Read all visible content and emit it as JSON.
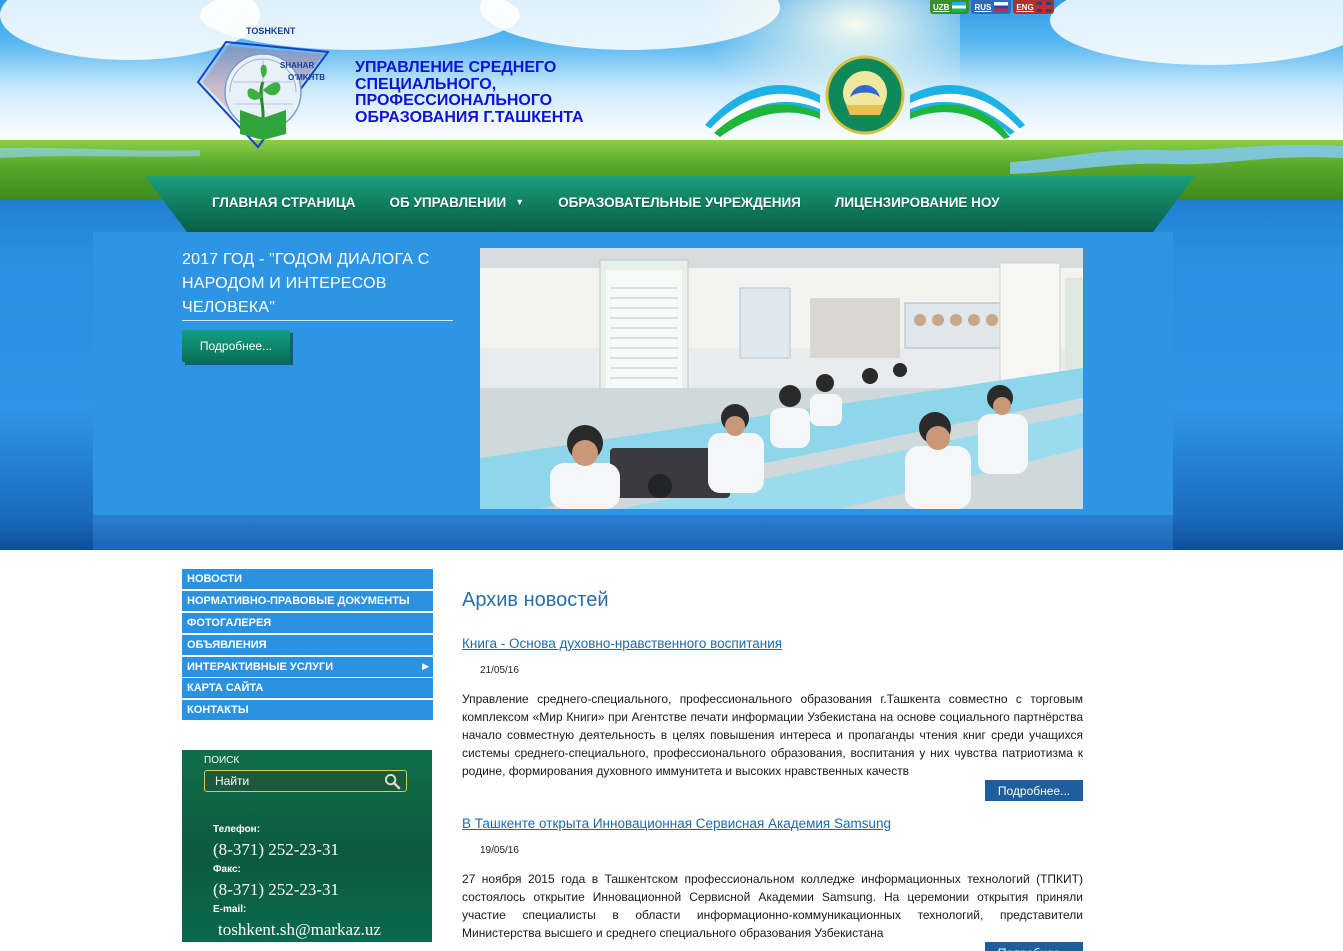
{
  "languages": [
    {
      "code": "UZB"
    },
    {
      "code": "RUS"
    },
    {
      "code": "ENG"
    }
  ],
  "logo": {
    "text_lines": [
      "TOSHKENT",
      "SHAHAR",
      "O'MKHTB"
    ]
  },
  "site_title": "УПРАВЛЕНИЕ СРЕДНЕГО СПЕЦИАЛЬНОГО, ПРОФЕССИОНАЛЬНОГО ОБРАЗОВАНИЯ г.ТАШКЕНТА",
  "nav": [
    {
      "label": "ГЛАВНАЯ СТРАНИЦА"
    },
    {
      "label": "ОБ УПРАВЛЕНИИ",
      "dropdown": true
    },
    {
      "label": "ОБРАЗОВАТЕЛЬНЫЕ УЧРЕЖДЕНИЯ"
    },
    {
      "label": "ЛИЦЕНЗИРОВАНИЕ НОУ"
    }
  ],
  "hero": {
    "slogan": "2017 ГОД - \"ГОДОМ ДИАЛОГА С НАРОДОМ И ИНТЕРЕСОВ ЧЕЛОВЕКА\"",
    "more_label": "Подробнее..."
  },
  "sidebar": {
    "menu": [
      {
        "label": "НОВОСТИ"
      },
      {
        "label": "НОРМАТИВНО-ПРАВОВЫЕ ДОКУМЕНТЫ"
      },
      {
        "label": "ФОТОГАЛЕРЕЯ"
      },
      {
        "label": "ОБЪЯВЛЕНИЯ"
      },
      {
        "label": "ИНТЕРАКТИВНЫЕ УСЛУГИ",
        "submenu": true
      },
      {
        "label": "КАРТА САЙТА"
      },
      {
        "label": "КОНТАКТЫ"
      }
    ],
    "search": {
      "label": "ПОИСК",
      "placeholder": "Найти"
    },
    "contacts": {
      "phone_label": "Телефон:",
      "phone": "(8-371) 252-23-31",
      "fax_label": "Факс:",
      "fax": "(8-371) 252-23-31",
      "email_label": "E-mail:",
      "email": "toshkent.sh@markaz.uz"
    }
  },
  "main": {
    "title": "Архив новостей",
    "news": [
      {
        "title": "Книга - Основа духовно-нравственного воспитания",
        "date": "21/05/16",
        "body": "Управление среднего-специального, профессионального образования г.Ташкента совместно с торговым комплексом «Мир Книги» при Агентстве печати информации Узбекистана на основе социального партнёрства начало совместную деятельность в целях повышения интереса и пропаганды чтения книг среди учащихся системы среднего-специального, профессионального образования, воспитания у них чувства патриотизма к родине, формирования духовного иммунитета и высоких нравственных качеств",
        "more_label": "Подробнее..."
      },
      {
        "title": "В Ташкенте открыта Инновационная Сервисная Академия Samsung",
        "date": "19/05/16",
        "body": "27 ноября 2015 года в Ташкентском профессиональном колледже информационных технологий (ТПКИТ) состоялось открытие Инновационной Сервисной Академии Samsung. На церемонии открытия приняли участие специалисты в области информационно-коммуникационных технологий, представители Министерства высшего и среднего специального образования Узбекистана",
        "more_label": "Подробнее..."
      }
    ]
  }
}
